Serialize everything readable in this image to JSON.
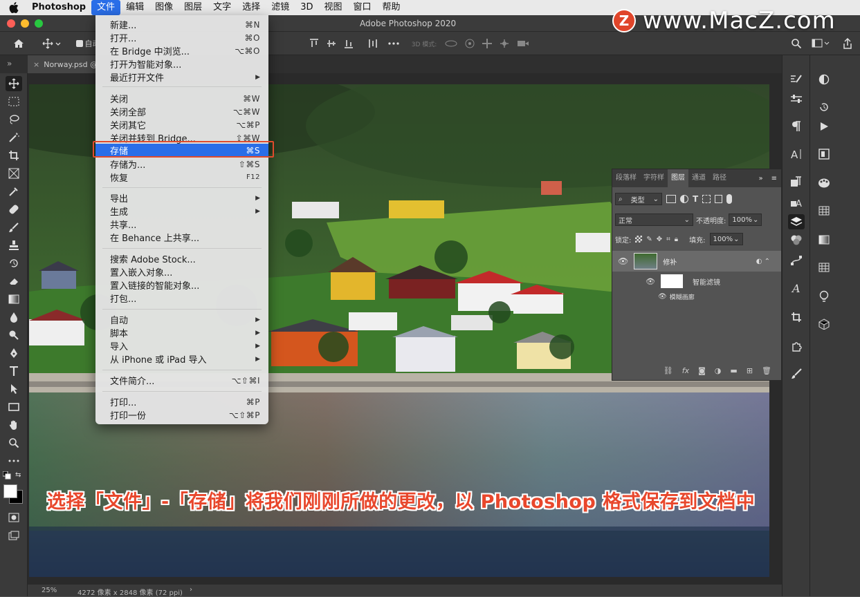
{
  "menubar": {
    "app_name": "Photoshop",
    "items": [
      "文件",
      "编辑",
      "图像",
      "图层",
      "文字",
      "选择",
      "滤镜",
      "3D",
      "视图",
      "窗口",
      "帮助"
    ]
  },
  "window": {
    "title": "Adobe Photoshop 2020"
  },
  "watermark": {
    "logo_letter": "Z",
    "text": "www.MacZ.com"
  },
  "optionsbar": {
    "auto_select_label": "自动",
    "mode_3d_label": "3D 模式:"
  },
  "document_tab": {
    "label": "Norway.psd @"
  },
  "file_menu": {
    "items": [
      {
        "label": "新建...",
        "shortcut": "⌘N"
      },
      {
        "label": "打开...",
        "shortcut": "⌘O"
      },
      {
        "label": "在 Bridge 中浏览...",
        "shortcut": "⌥⌘O"
      },
      {
        "label": "打开为智能对象...",
        "shortcut": ""
      },
      {
        "label": "最近打开文件",
        "shortcut": "▶"
      },
      {
        "label": "关闭",
        "shortcut": "⌘W"
      },
      {
        "label": "关闭全部",
        "shortcut": "⌥⌘W"
      },
      {
        "label": "关闭其它",
        "shortcut": "⌥⌘P"
      },
      {
        "label": "关闭并转到 Bridge...",
        "shortcut": "⇧⌘W"
      },
      {
        "label": "存储",
        "shortcut": "⌘S"
      },
      {
        "label": "存储为...",
        "shortcut": "⇧⌘S"
      },
      {
        "label": "恢复",
        "shortcut": "F12"
      },
      {
        "label": "导出",
        "shortcut": "▶"
      },
      {
        "label": "生成",
        "shortcut": "▶"
      },
      {
        "label": "共享...",
        "shortcut": ""
      },
      {
        "label": "在 Behance 上共享...",
        "shortcut": ""
      },
      {
        "label": "搜索 Adobe Stock...",
        "shortcut": ""
      },
      {
        "label": "置入嵌入对象...",
        "shortcut": ""
      },
      {
        "label": "置入链接的智能对象...",
        "shortcut": ""
      },
      {
        "label": "打包...",
        "shortcut": ""
      },
      {
        "label": "自动",
        "shortcut": "▶"
      },
      {
        "label": "脚本",
        "shortcut": "▶"
      },
      {
        "label": "导入",
        "shortcut": "▶"
      },
      {
        "label": "从 iPhone 或 iPad 导入",
        "shortcut": "▶"
      },
      {
        "label": "文件简介...",
        "shortcut": "⌥⇧⌘I"
      },
      {
        "label": "打印...",
        "shortcut": "⌘P"
      },
      {
        "label": "打印一份",
        "shortcut": "⌥⇧⌘P"
      }
    ]
  },
  "layers_panel": {
    "tabs": [
      "段落样",
      "字符样",
      "图层",
      "通道",
      "路径"
    ],
    "filter_label": "类型",
    "blend_mode": "正常",
    "opacity_label": "不透明度:",
    "opacity_value": "100%",
    "lock_label": "锁定:",
    "fill_label": "填充:",
    "fill_value": "100%",
    "layer_name": "修补",
    "smart_filter_label": "智能滤镜",
    "filter_effect_label": "模糊画廊"
  },
  "status": {
    "zoom": "25%",
    "doc_info": "4272 像素 x 2848 像素 (72 ppi)"
  },
  "caption": {
    "text": "选择「文件」-「存储」将我们刚刚所做的更改，以 Photoshop 格式保存到文档中"
  }
}
